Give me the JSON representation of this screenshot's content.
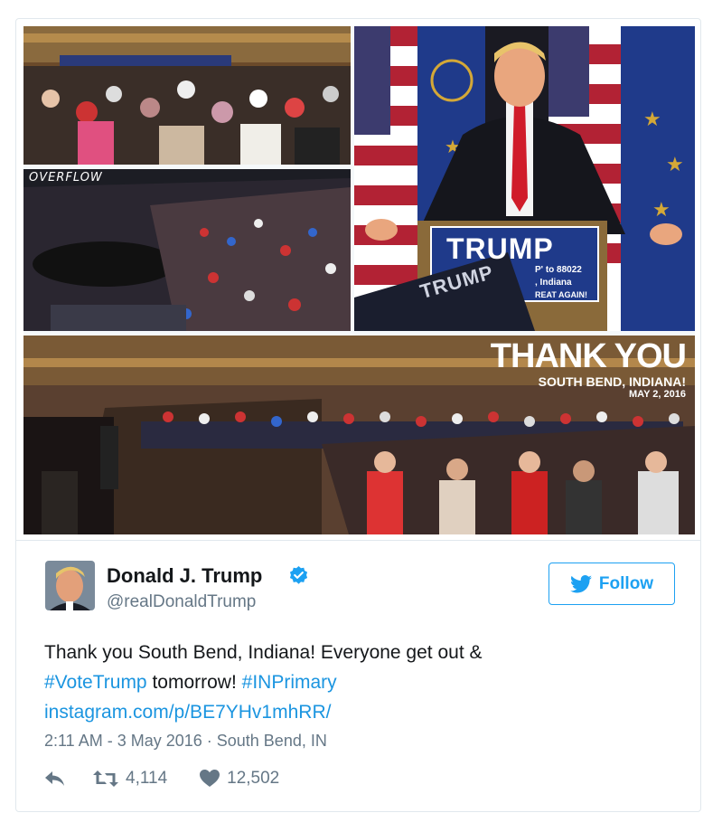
{
  "collage": {
    "overflow_label": "OVERFLOW",
    "podium_sign": "TRUMP",
    "podium_sub1": "P' to 88022",
    "podium_sub2": ", Indiana",
    "podium_sub3": "REAT AGAIN!",
    "held_sign": "TRUMP",
    "thank_you": "THANK YOU",
    "location": "SOUTH BEND, INDIANA!",
    "date": "MAY 2, 2016"
  },
  "author": {
    "name": "Donald J. Trump",
    "handle": "@realDonaldTrump",
    "verified": true
  },
  "follow_button": {
    "label": "Follow",
    "icon": "twitter-bird-icon"
  },
  "tweet": {
    "text_part1": "Thank you South Bend, Indiana! Everyone get out &",
    "hashtag1": "#VoteTrump",
    "text_part2": " tomorrow! ",
    "hashtag2": "#INPrimary",
    "url": "instagram.com/p/BE7YHv1mhRR/",
    "timestamp": "2:11 AM - 3 May 2016",
    "separator": " · ",
    "place": "South Bend, IN"
  },
  "actions": {
    "reply_icon": "reply-icon",
    "retweet_icon": "retweet-icon",
    "retweet_count": "4,114",
    "like_icon": "heart-icon",
    "like_count": "12,502"
  },
  "colors": {
    "accent": "#1da1f2",
    "link": "#1b95e0",
    "secondary_text": "#657786",
    "primary_text": "#14171a",
    "border": "#e1e8ed"
  }
}
